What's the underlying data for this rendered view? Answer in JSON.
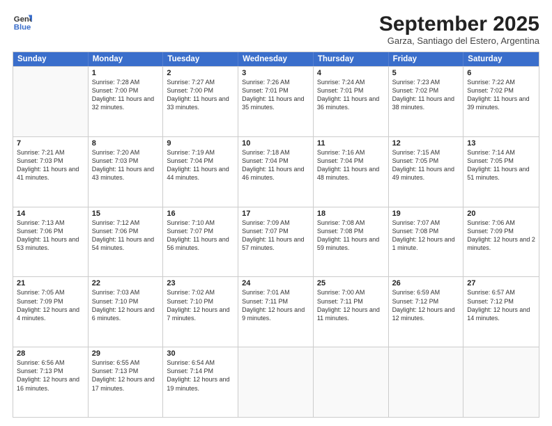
{
  "header": {
    "logo_line1": "General",
    "logo_line2": "Blue",
    "month": "September 2025",
    "location": "Garza, Santiago del Estero, Argentina"
  },
  "weekdays": [
    "Sunday",
    "Monday",
    "Tuesday",
    "Wednesday",
    "Thursday",
    "Friday",
    "Saturday"
  ],
  "rows": [
    [
      {
        "day": "",
        "empty": true
      },
      {
        "day": "1",
        "sunrise": "7:28 AM",
        "sunset": "7:00 PM",
        "daylight": "11 hours and 32 minutes."
      },
      {
        "day": "2",
        "sunrise": "7:27 AM",
        "sunset": "7:00 PM",
        "daylight": "11 hours and 33 minutes."
      },
      {
        "day": "3",
        "sunrise": "7:26 AM",
        "sunset": "7:01 PM",
        "daylight": "11 hours and 35 minutes."
      },
      {
        "day": "4",
        "sunrise": "7:24 AM",
        "sunset": "7:01 PM",
        "daylight": "11 hours and 36 minutes."
      },
      {
        "day": "5",
        "sunrise": "7:23 AM",
        "sunset": "7:02 PM",
        "daylight": "11 hours and 38 minutes."
      },
      {
        "day": "6",
        "sunrise": "7:22 AM",
        "sunset": "7:02 PM",
        "daylight": "11 hours and 39 minutes."
      }
    ],
    [
      {
        "day": "7",
        "sunrise": "7:21 AM",
        "sunset": "7:03 PM",
        "daylight": "11 hours and 41 minutes."
      },
      {
        "day": "8",
        "sunrise": "7:20 AM",
        "sunset": "7:03 PM",
        "daylight": "11 hours and 43 minutes."
      },
      {
        "day": "9",
        "sunrise": "7:19 AM",
        "sunset": "7:04 PM",
        "daylight": "11 hours and 44 minutes."
      },
      {
        "day": "10",
        "sunrise": "7:18 AM",
        "sunset": "7:04 PM",
        "daylight": "11 hours and 46 minutes."
      },
      {
        "day": "11",
        "sunrise": "7:16 AM",
        "sunset": "7:04 PM",
        "daylight": "11 hours and 48 minutes."
      },
      {
        "day": "12",
        "sunrise": "7:15 AM",
        "sunset": "7:05 PM",
        "daylight": "11 hours and 49 minutes."
      },
      {
        "day": "13",
        "sunrise": "7:14 AM",
        "sunset": "7:05 PM",
        "daylight": "11 hours and 51 minutes."
      }
    ],
    [
      {
        "day": "14",
        "sunrise": "7:13 AM",
        "sunset": "7:06 PM",
        "daylight": "11 hours and 53 minutes."
      },
      {
        "day": "15",
        "sunrise": "7:12 AM",
        "sunset": "7:06 PM",
        "daylight": "11 hours and 54 minutes."
      },
      {
        "day": "16",
        "sunrise": "7:10 AM",
        "sunset": "7:07 PM",
        "daylight": "11 hours and 56 minutes."
      },
      {
        "day": "17",
        "sunrise": "7:09 AM",
        "sunset": "7:07 PM",
        "daylight": "11 hours and 57 minutes."
      },
      {
        "day": "18",
        "sunrise": "7:08 AM",
        "sunset": "7:08 PM",
        "daylight": "11 hours and 59 minutes."
      },
      {
        "day": "19",
        "sunrise": "7:07 AM",
        "sunset": "7:08 PM",
        "daylight": "12 hours and 1 minute."
      },
      {
        "day": "20",
        "sunrise": "7:06 AM",
        "sunset": "7:09 PM",
        "daylight": "12 hours and 2 minutes."
      }
    ],
    [
      {
        "day": "21",
        "sunrise": "7:05 AM",
        "sunset": "7:09 PM",
        "daylight": "12 hours and 4 minutes."
      },
      {
        "day": "22",
        "sunrise": "7:03 AM",
        "sunset": "7:10 PM",
        "daylight": "12 hours and 6 minutes."
      },
      {
        "day": "23",
        "sunrise": "7:02 AM",
        "sunset": "7:10 PM",
        "daylight": "12 hours and 7 minutes."
      },
      {
        "day": "24",
        "sunrise": "7:01 AM",
        "sunset": "7:11 PM",
        "daylight": "12 hours and 9 minutes."
      },
      {
        "day": "25",
        "sunrise": "7:00 AM",
        "sunset": "7:11 PM",
        "daylight": "12 hours and 11 minutes."
      },
      {
        "day": "26",
        "sunrise": "6:59 AM",
        "sunset": "7:12 PM",
        "daylight": "12 hours and 12 minutes."
      },
      {
        "day": "27",
        "sunrise": "6:57 AM",
        "sunset": "7:12 PM",
        "daylight": "12 hours and 14 minutes."
      }
    ],
    [
      {
        "day": "28",
        "sunrise": "6:56 AM",
        "sunset": "7:13 PM",
        "daylight": "12 hours and 16 minutes."
      },
      {
        "day": "29",
        "sunrise": "6:55 AM",
        "sunset": "7:13 PM",
        "daylight": "12 hours and 17 minutes."
      },
      {
        "day": "30",
        "sunrise": "6:54 AM",
        "sunset": "7:14 PM",
        "daylight": "12 hours and 19 minutes."
      },
      {
        "day": "",
        "empty": true
      },
      {
        "day": "",
        "empty": true
      },
      {
        "day": "",
        "empty": true
      },
      {
        "day": "",
        "empty": true
      }
    ]
  ],
  "labels": {
    "sunrise": "Sunrise:",
    "sunset": "Sunset:",
    "daylight": "Daylight:"
  }
}
